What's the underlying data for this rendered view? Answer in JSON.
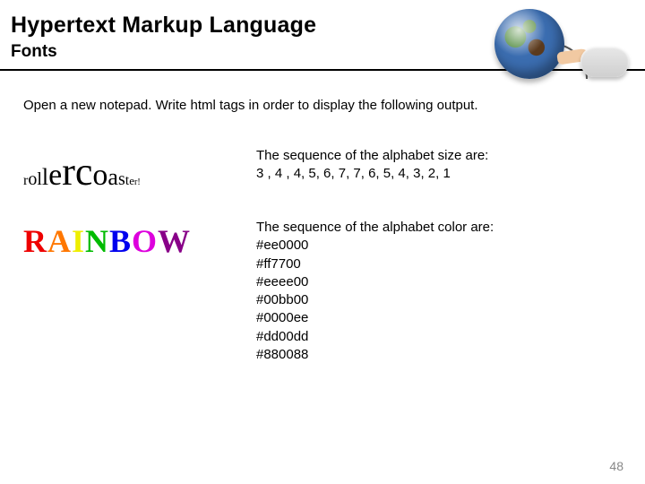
{
  "header": {
    "title": "Hypertext Markup Language",
    "subtitle": "Fonts"
  },
  "instruction": "Open a new notepad. Write html tags in order to display the following output.",
  "rollercoaster": {
    "letters": [
      "r",
      "o",
      "l",
      "l",
      "e",
      "r",
      "c",
      "o",
      "a",
      "s",
      "t",
      "e",
      "r",
      "!"
    ],
    "sizes": [
      3,
      4,
      4,
      5,
      6,
      7,
      7,
      6,
      5,
      4,
      3,
      2,
      1,
      1
    ],
    "desc_lead": "The sequence of the alphabet size are:",
    "desc_seq": "3 , 4 , 4, 5, 6, 7, 7, 6, 5, 4, 3, 2, 1"
  },
  "rainbow": {
    "letters": [
      "R",
      "A",
      "I",
      "N",
      "B",
      "O",
      "W"
    ],
    "colors": [
      "#ee0000",
      "#ff7700",
      "#eeee00",
      "#00bb00",
      "#0000ee",
      "#dd00dd",
      "#880088"
    ],
    "desc_lead": "The sequence of the alphabet color are:",
    "c0": "#ee0000",
    "c1": "#ff7700",
    "c2": "#eeee00",
    "c3": "#00bb00",
    "c4": "#0000ee",
    "c5": "#dd00dd",
    "c6": "#880088"
  },
  "page_number": "48"
}
